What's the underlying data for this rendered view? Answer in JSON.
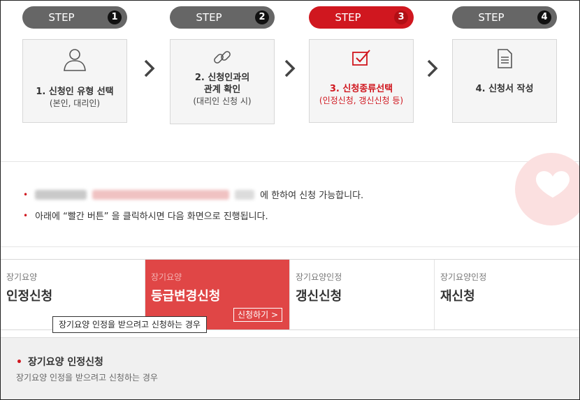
{
  "steps": [
    {
      "label": "STEP",
      "num": "1",
      "title": "1. 신청인 유형 선택",
      "sub": "(본인, 대리인)",
      "icon": "user-icon"
    },
    {
      "label": "STEP",
      "num": "2",
      "title": "2. 신청인과의 관계 확인",
      "title_l1": "2. 신청인과의",
      "title_l2": "관계 확인",
      "sub": "(대리인 신청 시)",
      "icon": "link-icon"
    },
    {
      "label": "STEP",
      "num": "3",
      "title": "3. 신청종류선택",
      "sub": "(인정신청, 갱신신청 등)",
      "icon": "checkbox-icon"
    },
    {
      "label": "STEP",
      "num": "4",
      "title": "4. 신청서 작성",
      "sub": "",
      "icon": "document-icon"
    }
  ],
  "info": {
    "line1_suffix": "에 한하여 신청 가능합니다.",
    "line2": "아래에 “빨간 버튼” 을 클릭하시면 다음 화면으로 진행됩니다."
  },
  "tabs": [
    {
      "small": "장기요양",
      "big": "인정신청"
    },
    {
      "small": "장기요양",
      "big": "등급변경신청",
      "button": "신청하기 >"
    },
    {
      "small": "장기요양인정",
      "big": "갱신신청"
    },
    {
      "small": "장기요양인정",
      "big": "재신청"
    }
  ],
  "tooltip": "장기요양 인정을 받으려고 신청하는 경우",
  "bottom": {
    "title": "장기요양 인정신청",
    "desc": "장기요양 인정을 받으려고 신청하는 경우"
  },
  "colors": {
    "accent": "#d0171f",
    "tab_active": "#e04646",
    "step_inactive": "#666666"
  }
}
